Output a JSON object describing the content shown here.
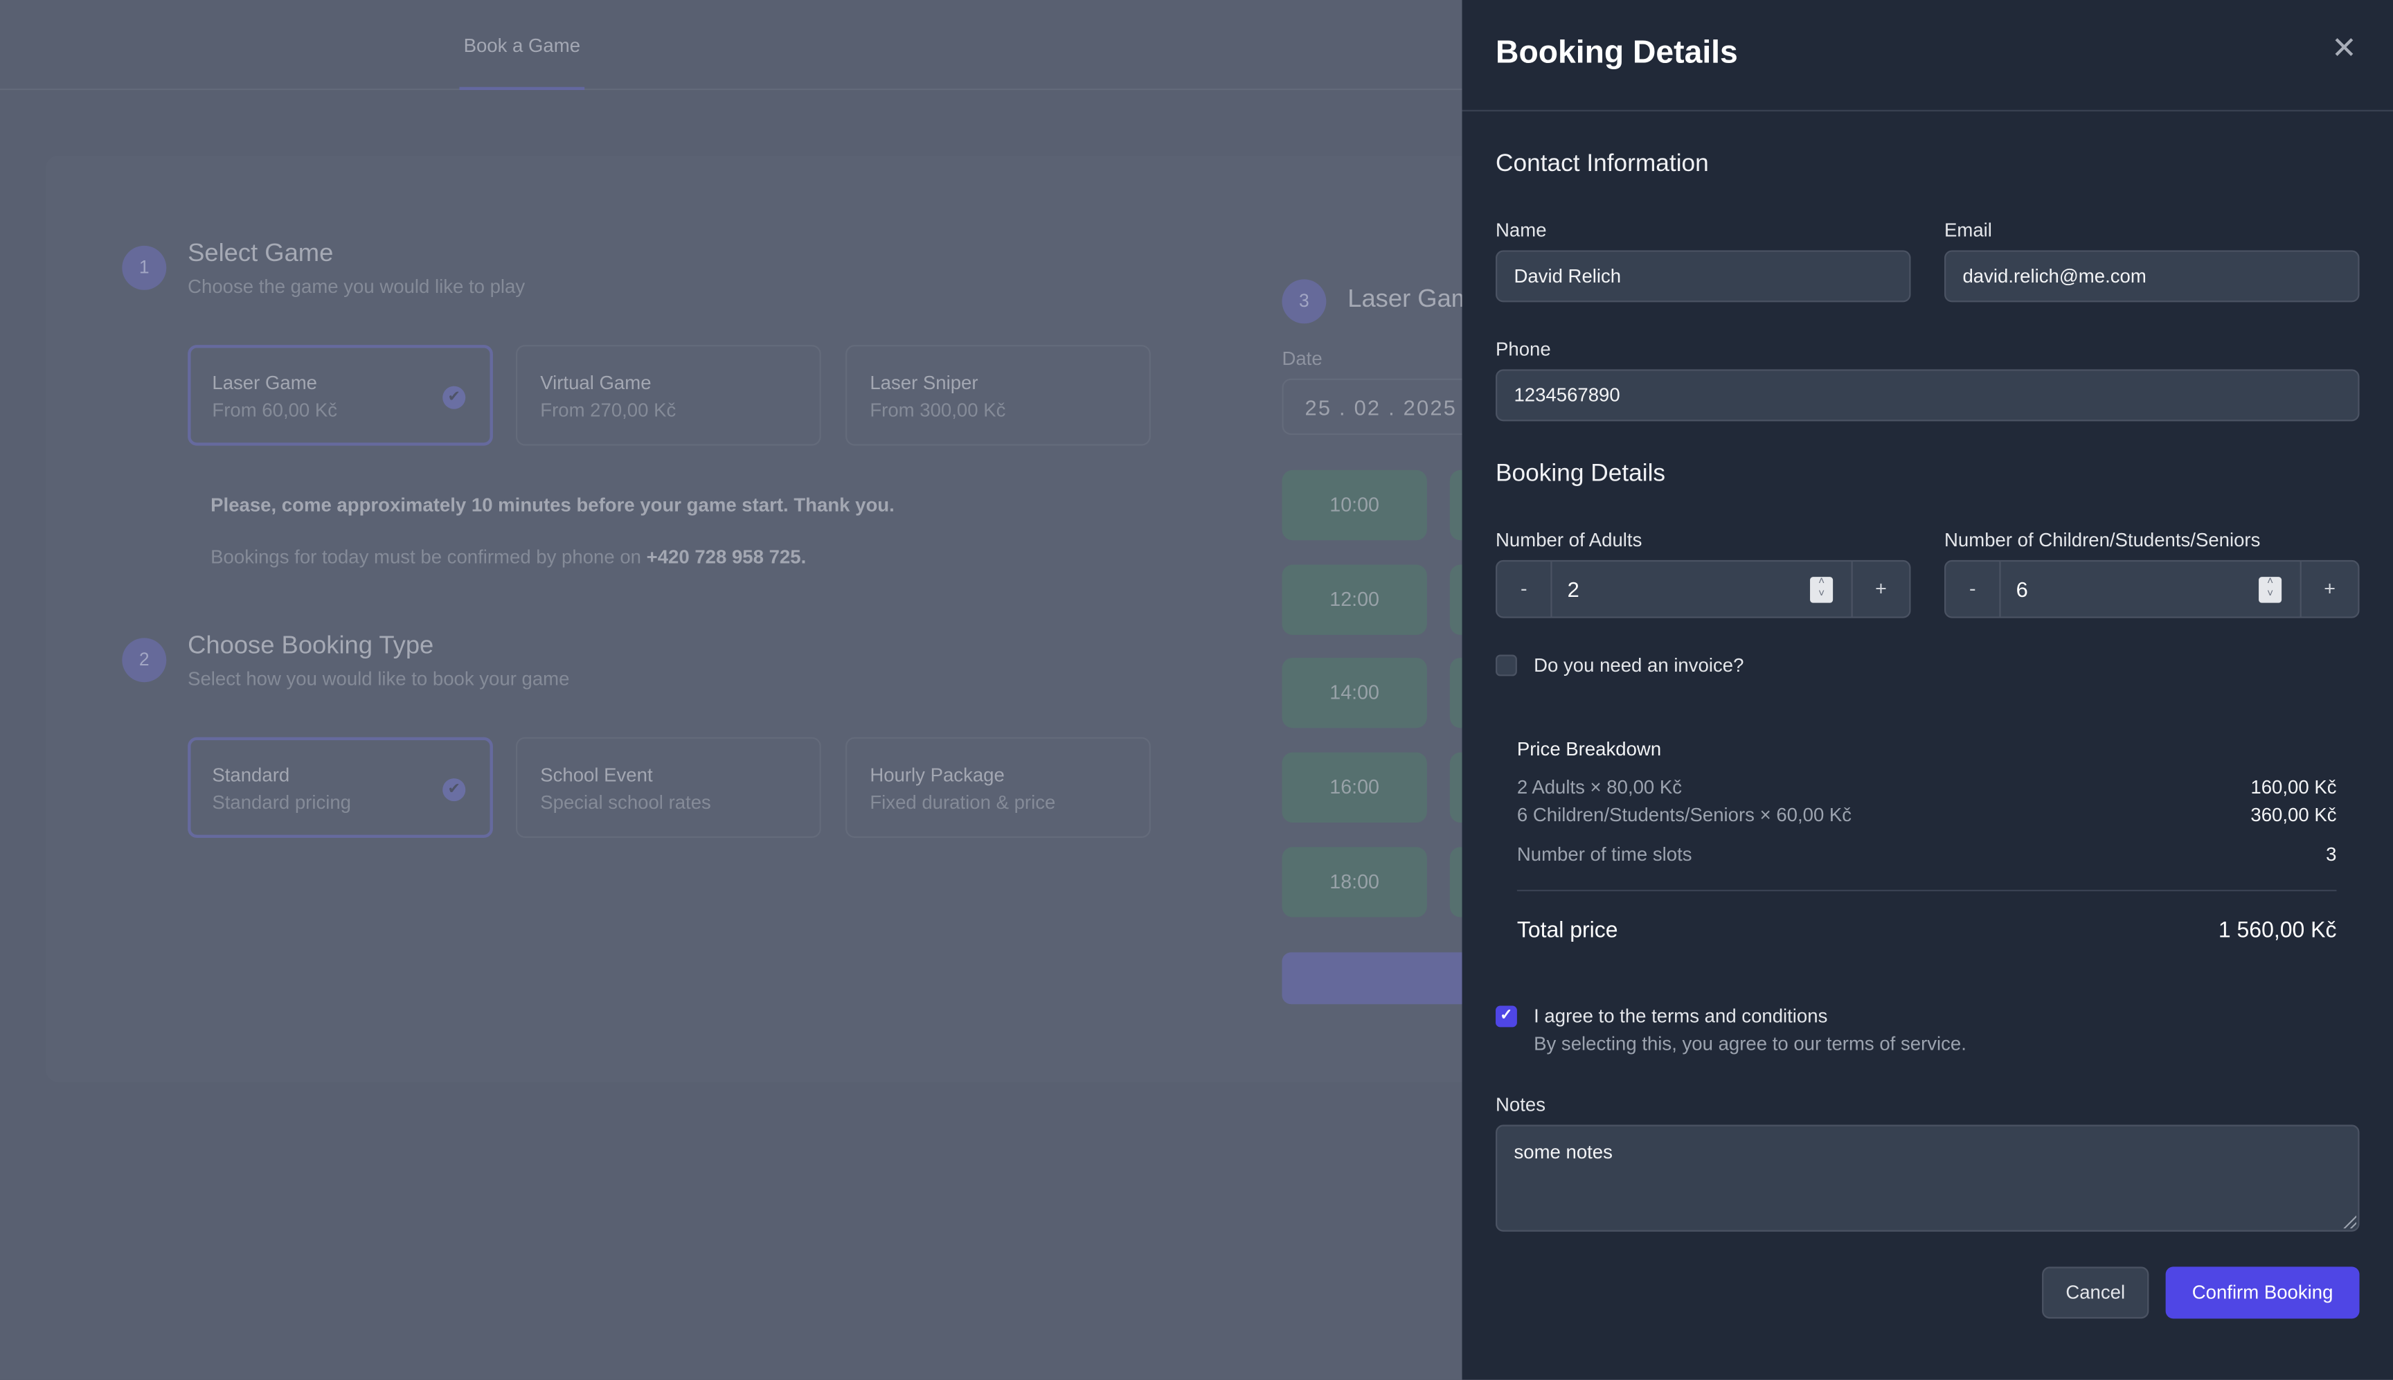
{
  "nav": {
    "tabs": [
      {
        "label": "Book a Game",
        "active": true
      }
    ]
  },
  "steps": [
    {
      "number": "1",
      "title": "Select Game",
      "subtitle": "Choose the game you would like to play",
      "options": [
        {
          "title": "Laser Game",
          "subtitle": "From 60,00 Kč",
          "selected": true
        },
        {
          "title": "Virtual Game",
          "subtitle": "From 270,00 Kč",
          "selected": false
        },
        {
          "title": "Laser Sniper",
          "subtitle": "From 300,00 Kč",
          "selected": false
        }
      ]
    },
    {
      "number": "2",
      "title": "Choose Booking Type",
      "subtitle": "Select how you would like to book your game",
      "options": [
        {
          "title": "Standard",
          "subtitle": "Standard pricing",
          "selected": true
        },
        {
          "title": "School Event",
          "subtitle": "Special school rates",
          "selected": false
        },
        {
          "title": "Hourly Package",
          "subtitle": "Fixed duration & price",
          "selected": false
        }
      ]
    },
    {
      "number": "3",
      "title": "Laser Game"
    }
  ],
  "notices": {
    "arrival": "Please, come approximately 10 minutes before your game start. Thank you.",
    "phone_prefix": "Bookings for today must be confirmed by phone on ",
    "phone_number": "+420 728 958 725."
  },
  "schedule": {
    "date_label": "Date",
    "date_value": "25 . 02 . 2025",
    "time_slots": [
      "10:00",
      "12:00",
      "14:00",
      "16:00",
      "18:00"
    ]
  },
  "drawer": {
    "title": "Booking Details",
    "close_icon": "close-icon",
    "contact": {
      "section_title": "Contact Information",
      "name_label": "Name",
      "name_value": "David Relich",
      "email_label": "Email",
      "email_value": "david.relich@me.com",
      "phone_label": "Phone",
      "phone_value": "1234567890"
    },
    "booking": {
      "section_title": "Booking Details",
      "adults_label": "Number of Adults",
      "adults_value": "2",
      "children_label": "Number of Children/Students/Seniors",
      "children_value": "6",
      "minus_label": "-",
      "plus_label": "+",
      "invoice_label": "Do you need an invoice?",
      "invoice_checked": false
    },
    "price_breakdown": {
      "title": "Price Breakdown",
      "lines": [
        {
          "label": "2 Adults × 80,00 Kč",
          "value": "160,00 Kč"
        },
        {
          "label": "6 Children/Students/Seniors × 60,00 Kč",
          "value": "360,00 Kč"
        }
      ],
      "time_slots_label": "Number of time slots",
      "time_slots_value": "3",
      "total_label": "Total price",
      "total_value": "1 560,00 Kč"
    },
    "terms": {
      "label": "I agree to the terms and conditions",
      "sublabel": "By selecting this, you agree to our terms of service.",
      "checked": true
    },
    "notes": {
      "label": "Notes",
      "value": "some notes"
    },
    "buttons": {
      "cancel": "Cancel",
      "confirm": "Confirm Booking"
    }
  },
  "colors": {
    "accent": "#4f46e5",
    "drawer_bg": "#212938",
    "input_bg": "#374151",
    "slot_bg": "#56706f"
  }
}
